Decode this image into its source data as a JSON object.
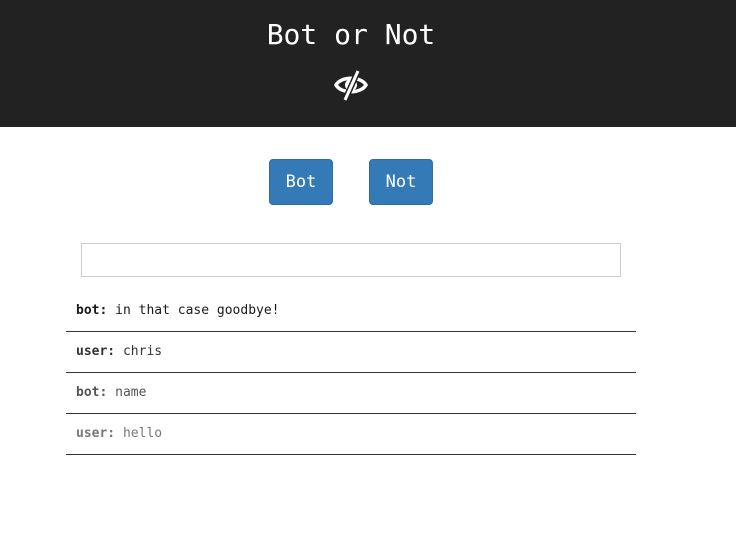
{
  "header": {
    "title": "Bot or Not",
    "logo_icon": "eye-slash-icon"
  },
  "buttons": {
    "bot_label": "Bot",
    "not_label": "Not",
    "color": "#337ab7"
  },
  "input": {
    "value": "",
    "placeholder": ""
  },
  "messages": [
    {
      "speaker": "bot:",
      "text": "in that case goodbye!",
      "color": "#1a1a1a"
    },
    {
      "speaker": "user:",
      "text": "chris",
      "color": "#333333"
    },
    {
      "speaker": "bot:",
      "text": "name",
      "color": "#555555"
    },
    {
      "speaker": "user:",
      "text": "hello",
      "color": "#777777"
    }
  ]
}
